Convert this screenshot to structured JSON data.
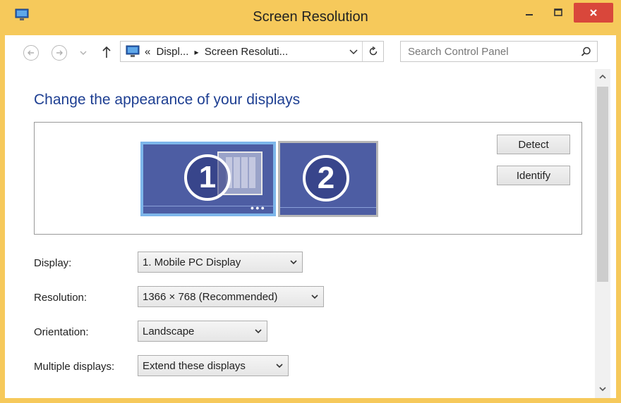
{
  "window": {
    "title": "Screen Resolution"
  },
  "address_bar": {
    "overflow": "«",
    "crumb1": "Displ...",
    "separator": "▸",
    "crumb2": "Screen Resoluti..."
  },
  "search": {
    "placeholder": "Search Control Panel"
  },
  "page": {
    "heading": "Change the appearance of your displays"
  },
  "displays": [
    {
      "number": "1",
      "selected": true
    },
    {
      "number": "2",
      "selected": false
    }
  ],
  "buttons": {
    "detect": "Detect",
    "identify": "Identify"
  },
  "settings": {
    "display": {
      "label": "Display:",
      "value": "1. Mobile PC Display"
    },
    "resolution": {
      "label": "Resolution:",
      "value": "1366 × 768 (Recommended)"
    },
    "orientation": {
      "label": "Orientation:",
      "value": "Landscape"
    },
    "multiple": {
      "label": "Multiple displays:",
      "value": "Extend these displays"
    }
  },
  "colors": {
    "titlebar": "#f6c95b",
    "close": "#d9473b",
    "heading": "#1e3f92",
    "monitor_fill": "#4d5da3",
    "selected_border": "#7db6ea"
  }
}
